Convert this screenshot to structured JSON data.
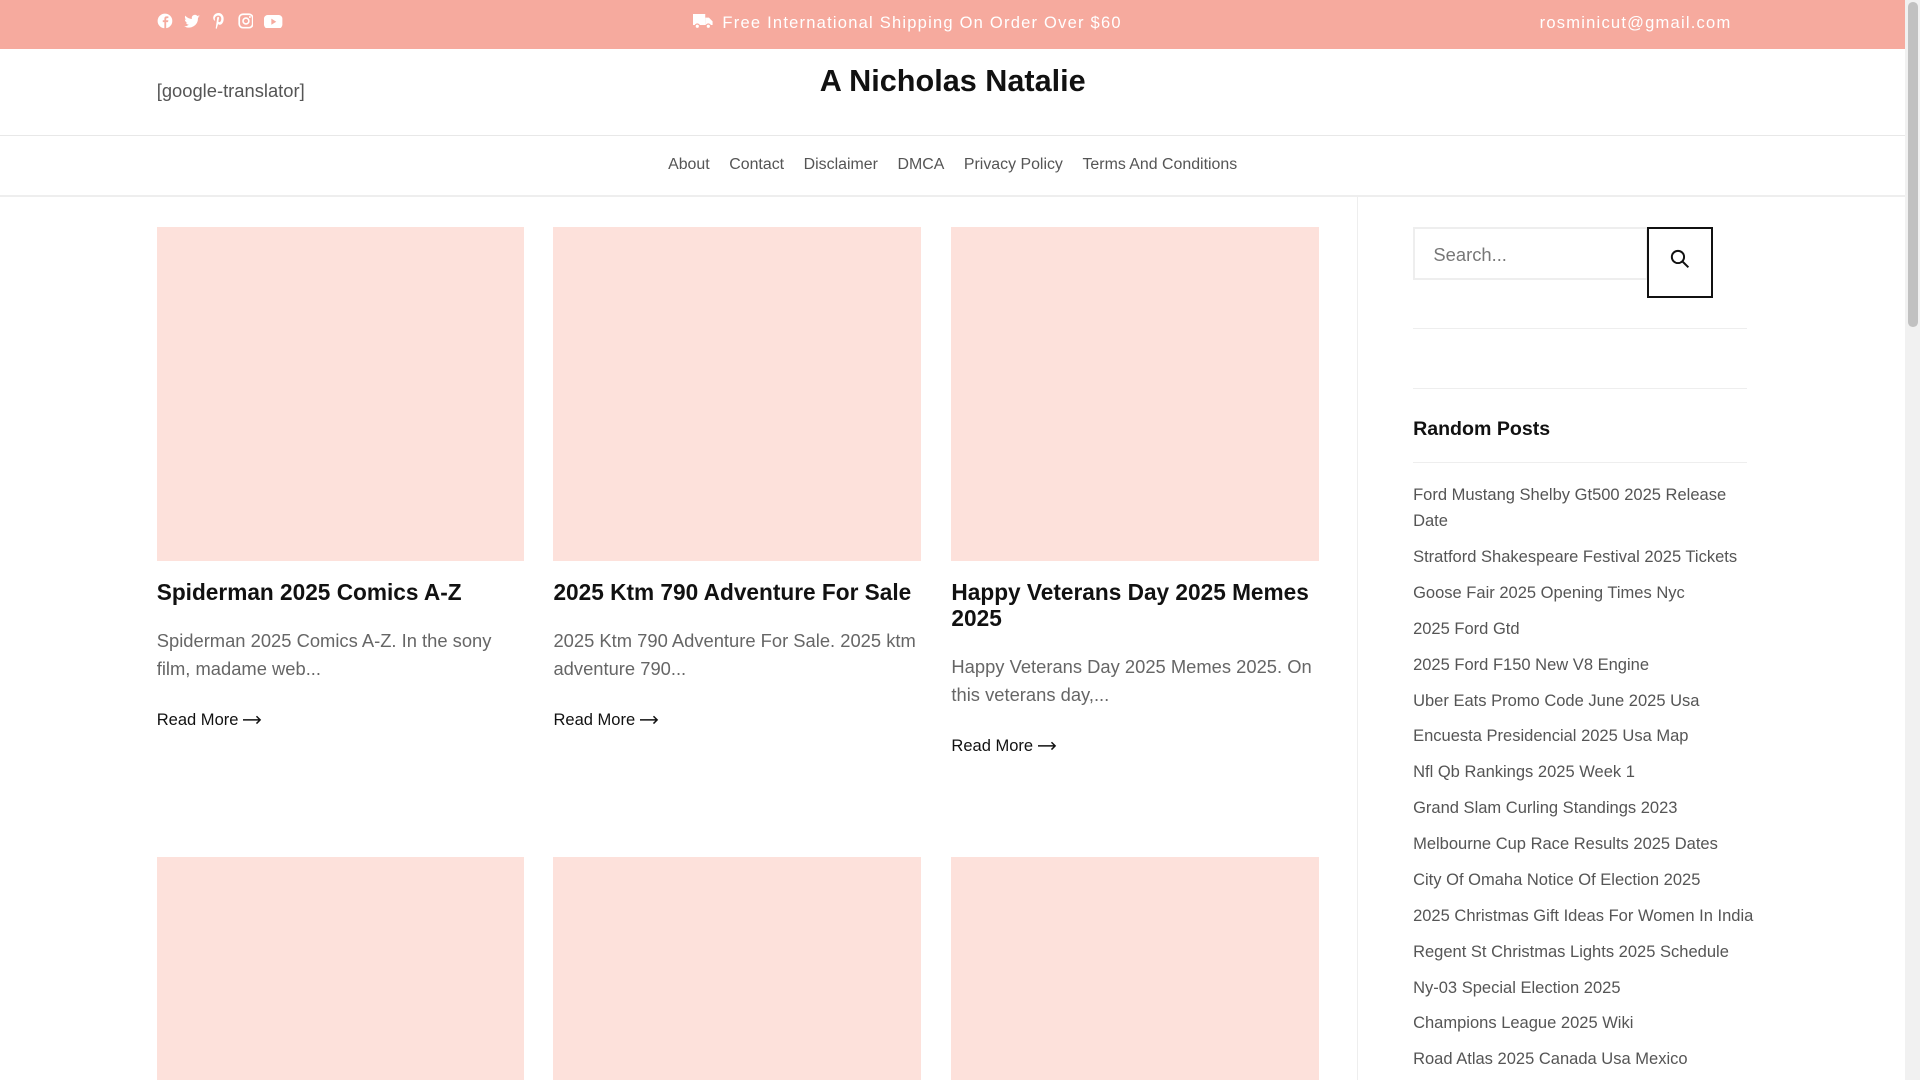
{
  "topbar": {
    "shipping": "Free International Shipping On Order Over $60",
    "email": "rosminicut@gmail.com",
    "social": [
      "facebook-icon",
      "twitter-icon",
      "pinterest-icon",
      "instagram-icon",
      "youtube-icon"
    ]
  },
  "header": {
    "translator": "[google-translator]",
    "site_title": "A Nicholas Natalie"
  },
  "nav": [
    "About",
    "Contact",
    "Disclaimer",
    "DMCA",
    "Privacy Policy",
    "Terms And Conditions"
  ],
  "posts": [
    {
      "title": "Spiderman 2025 Comics A-Z",
      "excerpt": "Spiderman 2025 Comics A-Z. In the sony film, madame web...",
      "read_more": "Read More"
    },
    {
      "title": "2025 Ktm 790 Adventure For Sale",
      "excerpt": "2025 Ktm 790 Adventure For Sale. 2025 ktm adventure 790...",
      "read_more": "Read More"
    },
    {
      "title": "Happy Veterans Day 2025 Memes 2025",
      "excerpt": "Happy Veterans Day 2025 Memes 2025. On this veterans day,...",
      "read_more": "Read More"
    }
  ],
  "sidebar": {
    "search_placeholder": "Search...",
    "random_heading": "Random Posts",
    "random_posts": [
      "Ford Mustang Shelby Gt500 2025 Release Date",
      "Stratford Shakespeare Festival 2025 Tickets",
      "Goose Fair 2025 Opening Times Nyc",
      "2025 Ford Gtd",
      "2025 Ford F150 New V8 Engine",
      "Uber Eats Promo Code June 2025 Usa",
      "Encuesta Presidencial 2025 Usa Map",
      "Nfl Qb Rankings 2025 Week 1",
      "Grand Slam Curling Standings 2023",
      "Melbourne Cup Race Results 2025 Dates",
      "City Of Omaha Notice Of Election 2025",
      "2025 Christmas Gift Ideas For Women In India",
      "Regent St Christmas Lights 2025 Schedule",
      "Ny-03 Special Election 2025",
      "Champions League 2025 Wiki",
      "Road Atlas 2025 Canada Usa Mexico"
    ]
  }
}
